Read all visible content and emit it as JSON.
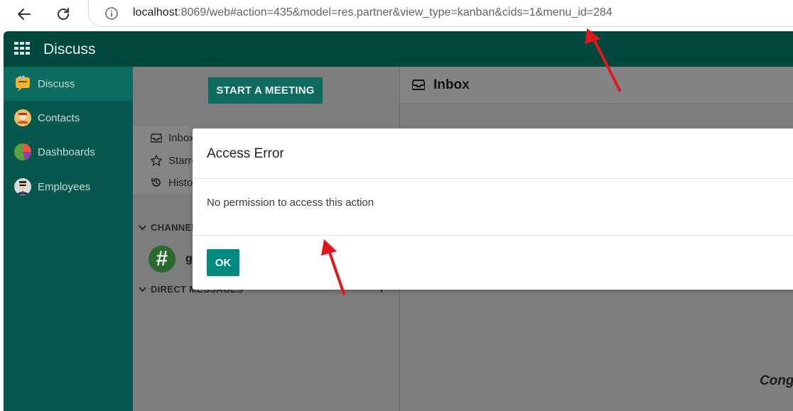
{
  "browser": {
    "url_host": "localhost",
    "url_rest": ":8069/web#action=435&model=res.partner&view_type=kanban&cids=1&menu_id=284"
  },
  "app": {
    "title": "Discuss",
    "header_color": "#00473e",
    "menu_color": "#06584e"
  },
  "side_menu": {
    "items": [
      {
        "label": "Discuss",
        "icon": "discuss-app-icon",
        "active": true
      },
      {
        "label": "Contacts",
        "icon": "contacts-app-icon",
        "active": false
      },
      {
        "label": "Dashboards",
        "icon": "dashboards-app-icon",
        "active": false
      },
      {
        "label": "Employees",
        "icon": "employees-app-icon",
        "active": false
      }
    ]
  },
  "discuss": {
    "start_meeting": "START A MEETING",
    "mailboxes": [
      {
        "label": "Inbox",
        "icon": "inbox-icon"
      },
      {
        "label": "Starred",
        "icon": "star-icon"
      },
      {
        "label": "History",
        "icon": "history-icon"
      }
    ],
    "channels_header": "CHANNELS",
    "channel": {
      "avatar": "#",
      "name": "general"
    },
    "dm_header": "DIRECT MESSAGES",
    "dm_add": "+"
  },
  "main": {
    "title": "Inbox",
    "congrats": "Congratulations, your inbox is empty"
  },
  "modal": {
    "title": "Access Error",
    "message": "No permission to access this action",
    "ok_label": "OK",
    "ok_color": "#018a80"
  },
  "annotation_color": "#e0181d"
}
